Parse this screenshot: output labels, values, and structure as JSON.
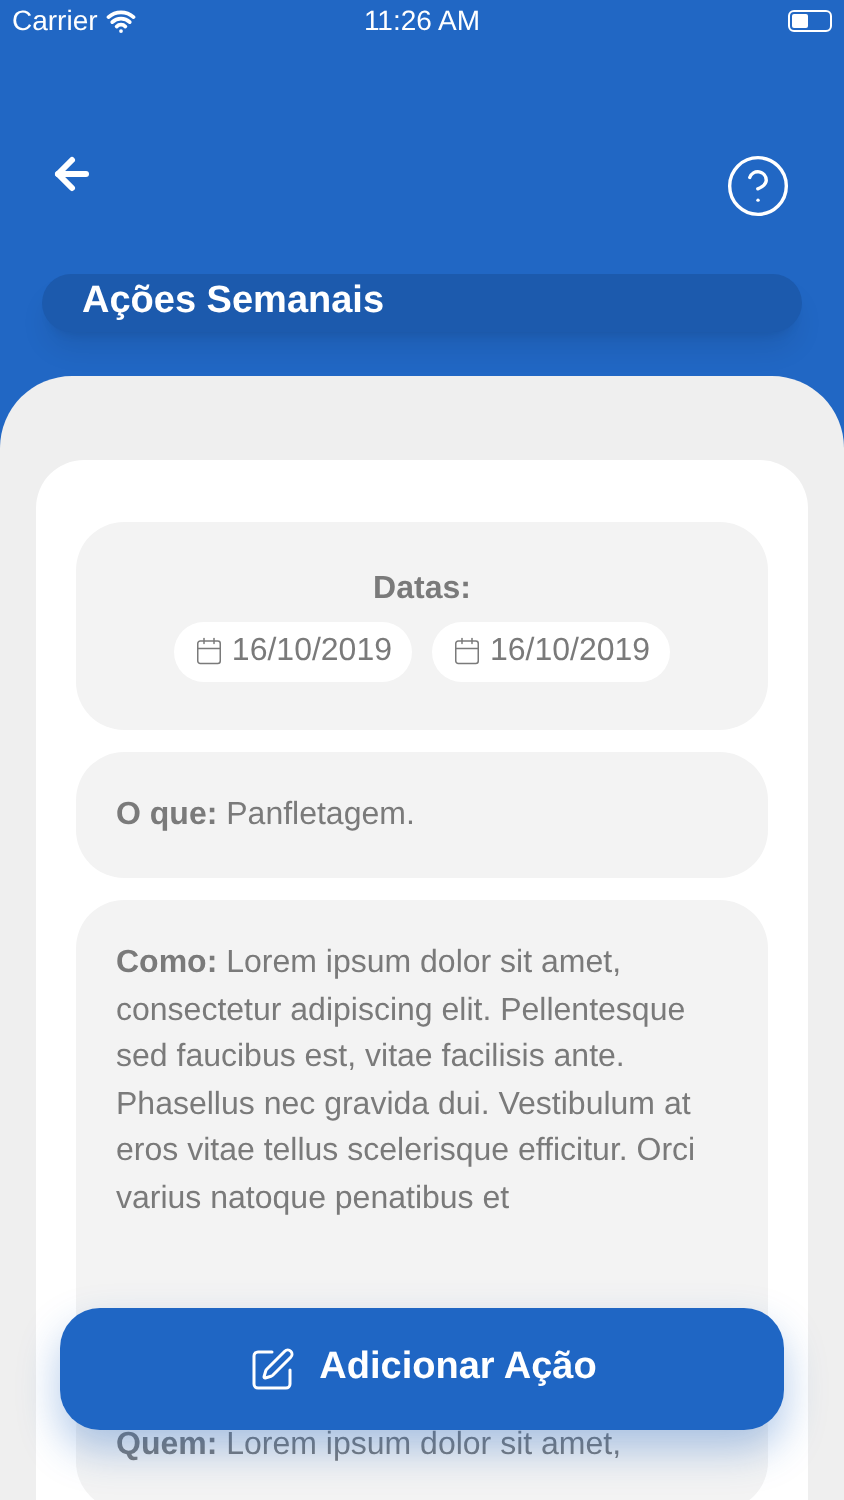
{
  "status_bar": {
    "carrier": "Carrier",
    "time": "11:26 AM"
  },
  "header": {
    "title": "Ações Semanais"
  },
  "dates": {
    "label": "Datas:",
    "values": [
      "16/10/2019",
      "16/10/2019"
    ]
  },
  "sections": [
    {
      "text": "**O que:** Panfletagem."
    },
    {
      "text": "**Como:** Lorem ipsum dolor sit amet, consectetur adipiscing elit. Pellentesque sed faucibus est, vitae facilisis ante. Phasellus nec gravida dui. Vestibulum at eros vitae tellus scelerisque efficitur. Orci varius natoque penatibus et"
    },
    {
      "text": "**Quem:** Lorem ipsum dolor sit amet,"
    }
  ],
  "add_button": {
    "label": "Adicionar Ação"
  }
}
